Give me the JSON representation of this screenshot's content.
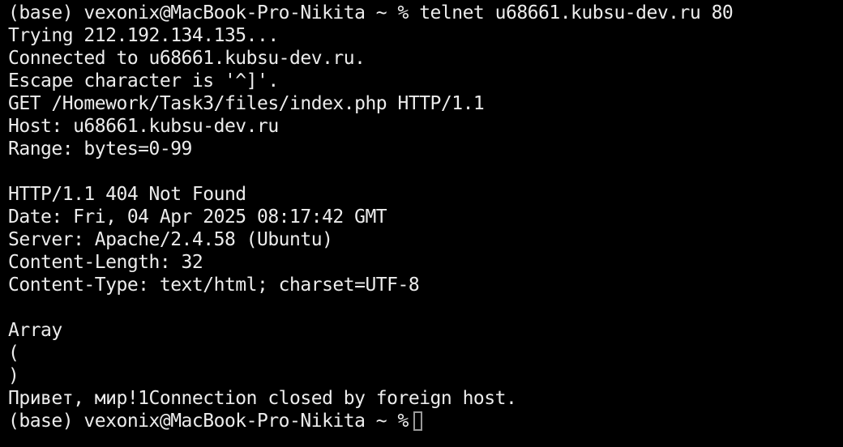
{
  "terminal": {
    "lines": [
      "(base) vexonix@MacBook-Pro-Nikita ~ % telnet u68661.kubsu-dev.ru 80",
      "Trying 212.192.134.135...",
      "Connected to u68661.kubsu-dev.ru.",
      "Escape character is '^]'.",
      "GET /Homework/Task3/files/index.php HTTP/1.1",
      "Host: u68661.kubsu-dev.ru",
      "Range: bytes=0-99",
      "",
      "HTTP/1.1 404 Not Found",
      "Date: Fri, 04 Apr 2025 08:17:42 GMT",
      "Server: Apache/2.4.58 (Ubuntu)",
      "Content-Length: 32",
      "Content-Type: text/html; charset=UTF-8",
      "",
      "Array",
      "(",
      ")",
      "Привет, мир!1Connection closed by foreign host."
    ],
    "prompt": "(base) vexonix@MacBook-Pro-Nikita ~ %",
    "colors": {
      "background": "#000000",
      "text": "#ececec",
      "cursor": "#9a9a9a"
    }
  }
}
